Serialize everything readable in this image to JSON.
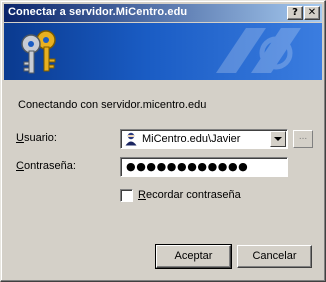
{
  "window": {
    "title": "Conectar a servidor.MiCentro.edu",
    "help_label": "?",
    "close_label": "✕"
  },
  "dialog": {
    "connecting_text": "Conectando con servidor.micentro.edu",
    "user_label_accel": "U",
    "user_label_rest": "suario:",
    "user_value": "MiCentro.edu\\Javier",
    "browse_label": "...",
    "password_label_accel": "C",
    "password_label_rest": "ontraseña:",
    "password_value": "●●●●●●●●●●●●",
    "remember_checked": false,
    "remember_label_accel": "R",
    "remember_label_rest": "ecordar contraseña",
    "ok_label": "Aceptar",
    "cancel_label": "Cancelar"
  },
  "colors": {
    "titlebar_start": "#0a246a",
    "titlebar_end": "#a6caf0",
    "banner": "#1a5cc4",
    "face": "#d4d0c8"
  }
}
